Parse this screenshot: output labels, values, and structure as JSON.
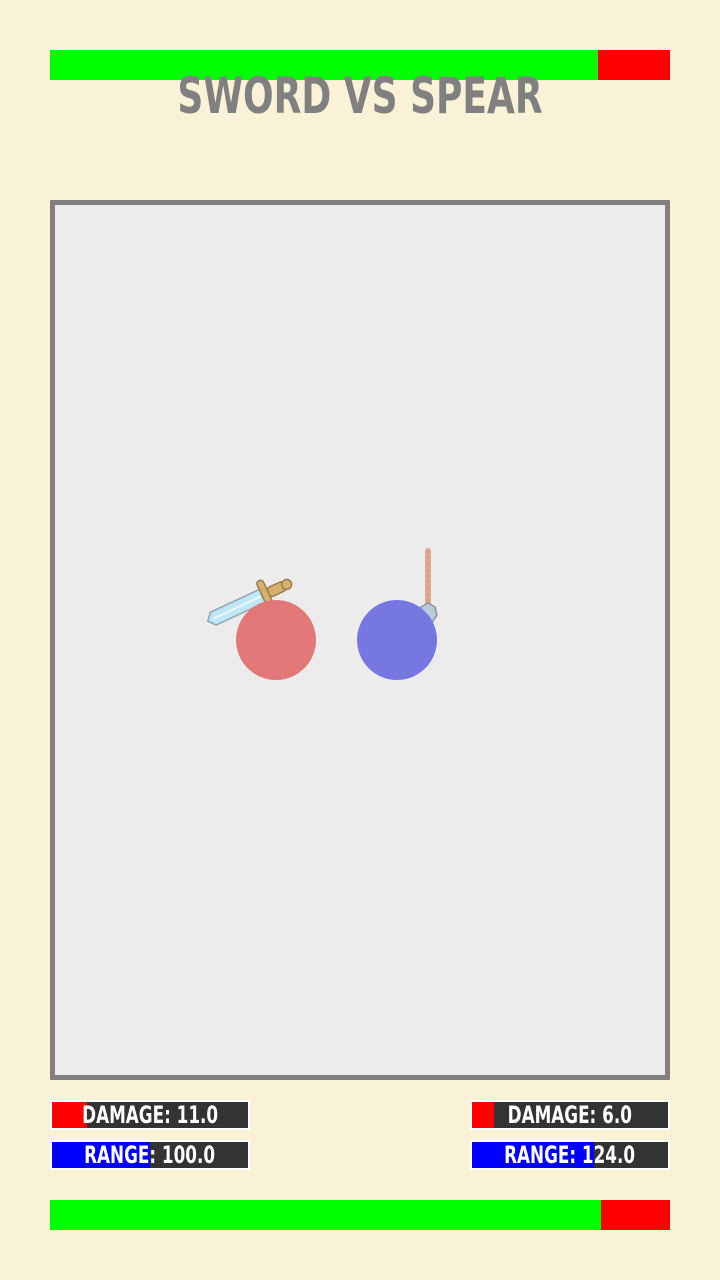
{
  "title": "SWORD VS SPEAR",
  "colors": {
    "background": "#f9f2d6",
    "hp_fill": "#00ff00",
    "hp_missing": "#ff0000",
    "arena_bg": "#ececec",
    "arena_border": "#808080",
    "damage_fill": "#ff0000",
    "range_fill": "#0000ff",
    "stat_bg": "#333333",
    "player1": "#e27777",
    "player2": "#7777e2"
  },
  "player1": {
    "weapon": "sword",
    "weapon_icon": "sword-icon",
    "hp_fraction": 0.884,
    "damage_label": "DAMAGE: 11.0",
    "damage_fraction": 0.18,
    "range_label": "RANGE: 100.0",
    "range_fraction": 0.5
  },
  "player2": {
    "weapon": "spear",
    "weapon_icon": "spear-icon",
    "hp_fraction": 0.889,
    "damage_label": "DAMAGE: 6.0",
    "damage_fraction": 0.11,
    "range_label": "RANGE: 124.0",
    "range_fraction": 0.62
  }
}
